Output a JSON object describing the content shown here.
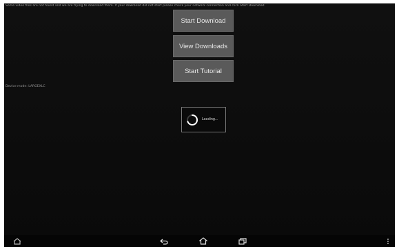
{
  "notice_text": "Some video files are not found and we are trying to download them. If your download did not start please check your network connection and click Start Download",
  "buttons": {
    "start_download": "Start Download",
    "view_downloads": "View Downloads",
    "start_tutorial": "Start Tutorial"
  },
  "device_mode": "Device mode: LARGEXLC",
  "loading": {
    "text": "Loading..."
  },
  "navbar": {
    "icons": [
      "home-left-icon",
      "back-icon",
      "home-icon",
      "recent-apps-icon",
      "menu-icon"
    ]
  },
  "colors": {
    "background": "#0e0e0e",
    "button": "#5a5a5a",
    "button_text": "#e8e8e8",
    "spinner": "#ffffff"
  }
}
